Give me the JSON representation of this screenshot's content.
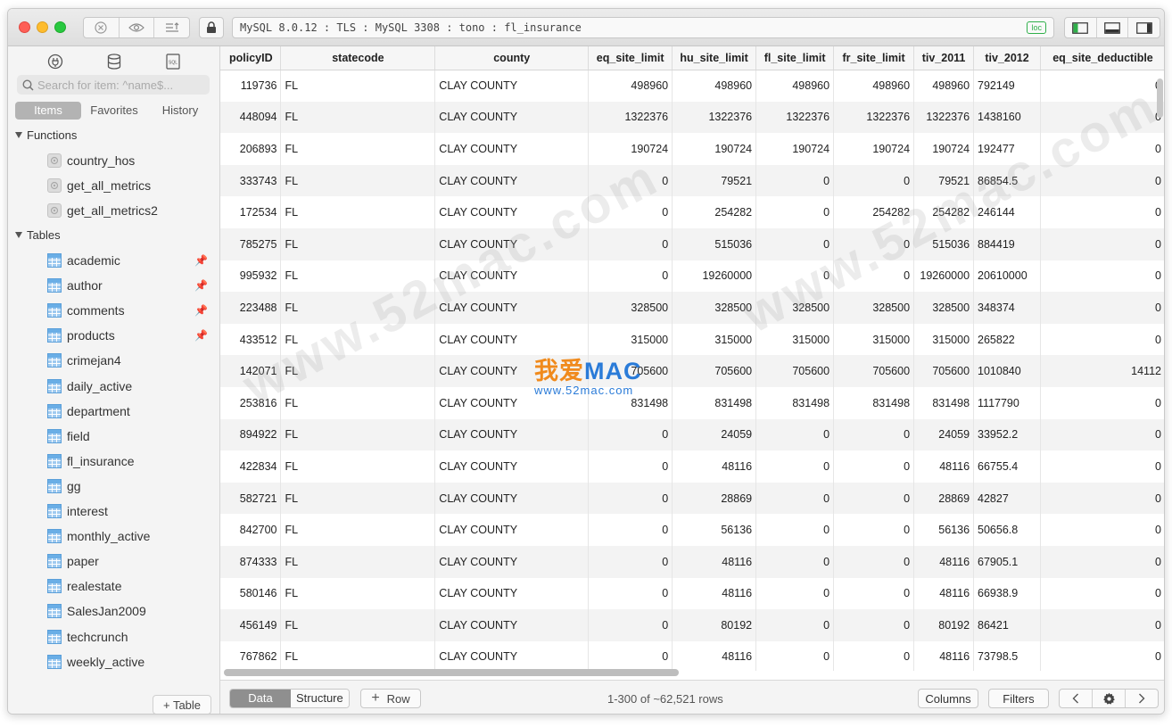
{
  "toolbar": {
    "connection": "MySQL 8.0.12 : TLS : MySQL 3308 : tono : fl_insurance",
    "badge": "loc"
  },
  "sidebar": {
    "search_placeholder": "Search for item: ^name$...",
    "tabs": [
      "Items",
      "Favorites",
      "History"
    ],
    "functions_label": "Functions",
    "functions": [
      "country_hos",
      "get_all_metrics",
      "get_all_metrics2"
    ],
    "tables_label": "Tables",
    "tables": [
      {
        "name": "academic",
        "pinned": true
      },
      {
        "name": "author",
        "pinned": true
      },
      {
        "name": "comments",
        "pinned": true
      },
      {
        "name": "products",
        "pinned": true
      },
      {
        "name": "crimejan4",
        "pinned": false
      },
      {
        "name": "daily_active",
        "pinned": false
      },
      {
        "name": "department",
        "pinned": false
      },
      {
        "name": "field",
        "pinned": false
      },
      {
        "name": "fl_insurance",
        "pinned": false
      },
      {
        "name": "gg",
        "pinned": false
      },
      {
        "name": "interest",
        "pinned": false
      },
      {
        "name": "monthly_active",
        "pinned": false
      },
      {
        "name": "paper",
        "pinned": false
      },
      {
        "name": "realestate",
        "pinned": false
      },
      {
        "name": "SalesJan2009",
        "pinned": false
      },
      {
        "name": "techcrunch",
        "pinned": false
      },
      {
        "name": "weekly_active",
        "pinned": false
      }
    ],
    "add_table_label": "+ Table"
  },
  "grid": {
    "columns": [
      "policyID",
      "statecode",
      "county",
      "eq_site_limit",
      "hu_site_limit",
      "fl_site_limit",
      "fr_site_limit",
      "tiv_2011",
      "tiv_2012",
      "eq_site_deductible"
    ],
    "rows": [
      [
        "119736",
        "FL",
        "CLAY COUNTY",
        "498960",
        "498960",
        "498960",
        "498960",
        "498960",
        "792149",
        "0"
      ],
      [
        "448094",
        "FL",
        "CLAY COUNTY",
        "1322376",
        "1322376",
        "1322376",
        "1322376",
        "1322376",
        "1438160",
        "0"
      ],
      [
        "206893",
        "FL",
        "CLAY COUNTY",
        "190724",
        "190724",
        "190724",
        "190724",
        "190724",
        "192477",
        "0"
      ],
      [
        "333743",
        "FL",
        "CLAY COUNTY",
        "0",
        "79521",
        "0",
        "0",
        "79521",
        "86854.5",
        "0"
      ],
      [
        "172534",
        "FL",
        "CLAY COUNTY",
        "0",
        "254282",
        "0",
        "254282",
        "254282",
        "246144",
        "0"
      ],
      [
        "785275",
        "FL",
        "CLAY COUNTY",
        "0",
        "515036",
        "0",
        "0",
        "515036",
        "884419",
        "0"
      ],
      [
        "995932",
        "FL",
        "CLAY COUNTY",
        "0",
        "19260000",
        "0",
        "0",
        "19260000",
        "20610000",
        "0"
      ],
      [
        "223488",
        "FL",
        "CLAY COUNTY",
        "328500",
        "328500",
        "328500",
        "328500",
        "328500",
        "348374",
        "0"
      ],
      [
        "433512",
        "FL",
        "CLAY COUNTY",
        "315000",
        "315000",
        "315000",
        "315000",
        "315000",
        "265822",
        "0"
      ],
      [
        "142071",
        "FL",
        "CLAY COUNTY",
        "705600",
        "705600",
        "705600",
        "705600",
        "705600",
        "1010840",
        "14112"
      ],
      [
        "253816",
        "FL",
        "CLAY COUNTY",
        "831498",
        "831498",
        "831498",
        "831498",
        "831498",
        "1117790",
        "0"
      ],
      [
        "894922",
        "FL",
        "CLAY COUNTY",
        "0",
        "24059",
        "0",
        "0",
        "24059",
        "33952.2",
        "0"
      ],
      [
        "422834",
        "FL",
        "CLAY COUNTY",
        "0",
        "48116",
        "0",
        "0",
        "48116",
        "66755.4",
        "0"
      ],
      [
        "582721",
        "FL",
        "CLAY COUNTY",
        "0",
        "28869",
        "0",
        "0",
        "28869",
        "42827",
        "0"
      ],
      [
        "842700",
        "FL",
        "CLAY COUNTY",
        "0",
        "56136",
        "0",
        "0",
        "56136",
        "50656.8",
        "0"
      ],
      [
        "874333",
        "FL",
        "CLAY COUNTY",
        "0",
        "48116",
        "0",
        "0",
        "48116",
        "67905.1",
        "0"
      ],
      [
        "580146",
        "FL",
        "CLAY COUNTY",
        "0",
        "48116",
        "0",
        "0",
        "48116",
        "66938.9",
        "0"
      ],
      [
        "456149",
        "FL",
        "CLAY COUNTY",
        "0",
        "80192",
        "0",
        "0",
        "80192",
        "86421",
        "0"
      ],
      [
        "767862",
        "FL",
        "CLAY COUNTY",
        "0",
        "48116",
        "0",
        "0",
        "48116",
        "73798.5",
        "0"
      ]
    ]
  },
  "watermark": {
    "text": "www.52mac.com",
    "brand_cn": "我爱",
    "brand_mac": "MAC",
    "brand_url": "www.52mac.com"
  },
  "bottombar": {
    "data_tab": "Data",
    "structure_tab": "Structure",
    "add_row_label": "Row",
    "row_count": "1-300 of ~62,521 rows",
    "columns_label": "Columns",
    "filters_label": "Filters"
  }
}
